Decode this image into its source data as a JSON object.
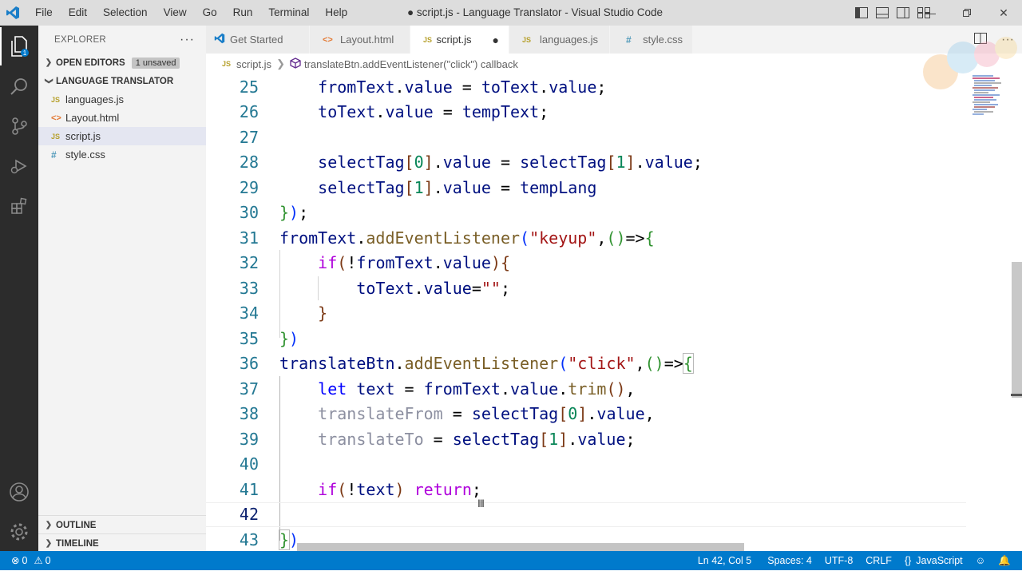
{
  "app": {
    "window_title": "● script.js - Language Translator - Visual Studio Code",
    "menu": [
      "File",
      "Edit",
      "Selection",
      "View",
      "Go",
      "Run",
      "Terminal",
      "Help"
    ]
  },
  "sidebar": {
    "explorer_label": "EXPLORER",
    "open_editors_label": "OPEN EDITORS",
    "unsaved_badge": "1 unsaved",
    "project_label": "LANGUAGE TRANSLATOR",
    "files": [
      {
        "name": "languages.js",
        "icon": "JS"
      },
      {
        "name": "Layout.html",
        "icon": "<>"
      },
      {
        "name": "script.js",
        "icon": "JS"
      },
      {
        "name": "style.css",
        "icon": "#"
      }
    ],
    "outline_label": "OUTLINE",
    "timeline_label": "TIMELINE"
  },
  "tabs": [
    {
      "label": "Get Started",
      "icon": "vscode-icon"
    },
    {
      "label": "Layout.html",
      "icon": "<>"
    },
    {
      "label": "script.js",
      "icon": "JS",
      "dirty": "●"
    },
    {
      "label": "languages.js",
      "icon": "JS"
    },
    {
      "label": "style.css",
      "icon": "#"
    }
  ],
  "breadcrumb": {
    "file": "script.js",
    "file_icon": "JS",
    "symbol": "translateBtn.addEventListener(\"click\") callback"
  },
  "editor": {
    "line_numbers": [
      "25",
      "26",
      "27",
      "28",
      "29",
      "30",
      "31",
      "32",
      "33",
      "34",
      "35",
      "36",
      "37",
      "38",
      "39",
      "40",
      "41",
      "42",
      "43"
    ],
    "current_line": "42"
  },
  "status": {
    "errors": "0",
    "warnings": "0",
    "position": "Ln 42, Col 5",
    "spaces": "Spaces: 4",
    "encoding": "UTF-8",
    "eol": "CRLF",
    "language_braces": "{}",
    "language": "JavaScript"
  },
  "colors": {
    "status_bar": "#007acc",
    "activity_bar": "#2c2c2c",
    "title_bar": "#dddddd"
  }
}
